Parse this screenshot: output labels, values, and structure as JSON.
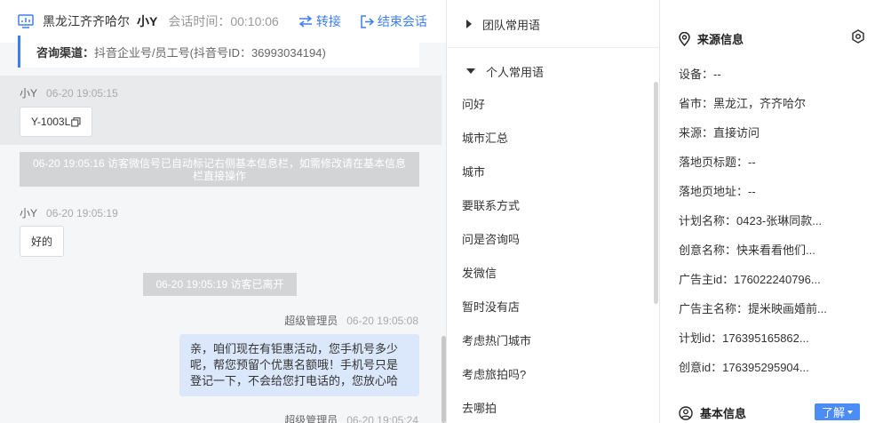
{
  "chat": {
    "header": {
      "location": "黑龙江齐齐哈尔",
      "visitor_name": "小Y",
      "session_time_label": "会话时间：",
      "session_time": "00:10:06",
      "transfer_label": "转接",
      "end_label": "结束会话"
    },
    "channel": {
      "label": "咨询渠道：",
      "value": "抖音企业号/员工号(抖音号ID：36993034194)"
    },
    "messages": [
      {
        "sender": "小Y",
        "time": "06-20 19:05:15",
        "text": "Y-1003L"
      },
      {
        "system": "06-20 19:05:16 访客微信号已自动标记右侧基本信息栏，如需修改请在基本信息栏直接操作"
      },
      {
        "sender": "小Y",
        "time": "06-20 19:05:19",
        "text": "好的"
      },
      {
        "system": "06-20 19:05:19 访客已离开"
      },
      {
        "sender": "超级管理员",
        "time": "06-20 19:05:08",
        "text": "亲，咱们现在有钜惠活动，您手机号多少呢，帮您预留个优惠名额哦！手机号只是登记一下，不会给您打电话的，您放心哈"
      },
      {
        "sender": "超级管理员",
        "time": "06-20 19:05:24"
      }
    ]
  },
  "phrases": {
    "team_group": "团队常用语",
    "personal_group": "个人常用语",
    "items": [
      "问好",
      "城市汇总",
      "城市",
      "要联系方式",
      "问是咨询吗",
      "发微信",
      "暂时没有店",
      "考虑热门城市",
      "考虑旅拍吗?",
      "去哪拍"
    ]
  },
  "info": {
    "source_title": "来源信息",
    "rows": [
      "设备：--",
      "省市：黑龙江，齐齐哈尔",
      "来源：直接访问",
      "落地页标题：--",
      "落地页地址：--",
      "计划名称：0423-张琳同款...",
      "创意名称：快来看看他们...",
      "广告主id：176022240796...",
      "广告主名称：提米映画婚前...",
      "计划id：176395165862...",
      "创意id：176395295904..."
    ],
    "basic_title": "基本信息",
    "learn_label": "了解"
  },
  "colors": {
    "accent": "#3d7ef0",
    "agent_bubble": "#dbe7fb",
    "system_note": "#d3d4d6"
  }
}
